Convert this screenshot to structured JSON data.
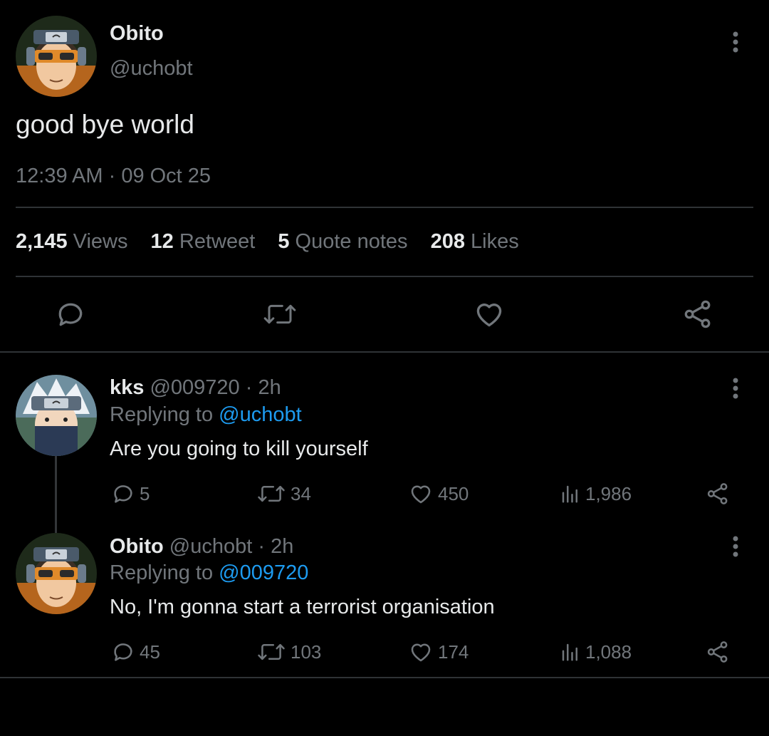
{
  "main_tweet": {
    "author_name": "Obito",
    "author_handle": "@uchobt",
    "text": "good bye world",
    "time": "12:39 AM",
    "date_separator": " · ",
    "date": "09 Oct 25",
    "stats": {
      "views_count": "2,145",
      "views_label": "Views",
      "retweets_count": "12",
      "retweets_label": "Retweet",
      "quotes_count": "5",
      "quotes_label": "Quote notes",
      "likes_count": "208",
      "likes_label": "Likes"
    },
    "actions": [
      "reply-icon",
      "retweet-icon",
      "heart-icon",
      "share-icon"
    ]
  },
  "replies": [
    {
      "name": "kks",
      "handle": "@009720",
      "time_separator": " · ",
      "time": "2h",
      "replying_prefix": "Replying to ",
      "replying_to": "@uchobt",
      "text": "Are you going to kill yourself",
      "reply_count": "5",
      "retweet_count": "34",
      "like_count": "450",
      "view_count": "1,986"
    },
    {
      "name": "Obito",
      "handle": "@uchobt",
      "time_separator": " · ",
      "time": "2h",
      "replying_prefix": "Replying to ",
      "replying_to": "@009720",
      "text": "No, I'm gonna start a terrorist organisation",
      "reply_count": "45",
      "retweet_count": "103",
      "like_count": "174",
      "view_count": "1,088"
    }
  ],
  "colors": {
    "background": "#000000",
    "text_primary": "#e7e9ea",
    "text_secondary": "#71767b",
    "link": "#1d9bf0",
    "divider": "#2f3336"
  }
}
